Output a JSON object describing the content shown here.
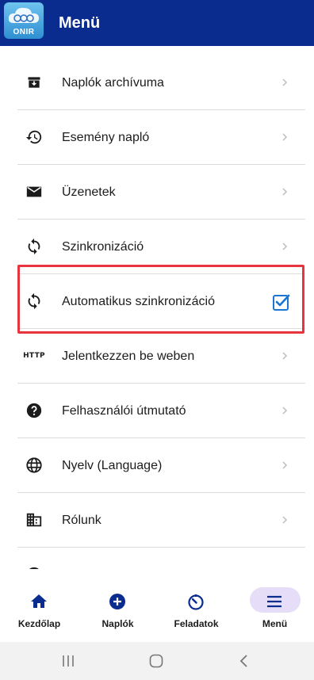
{
  "header": {
    "title": "Menü",
    "logo_text": "ONIR"
  },
  "menu": {
    "items": [
      {
        "label": "Naplók archívuma",
        "icon": "archive-icon"
      },
      {
        "label": "Esemény napló",
        "icon": "history-icon"
      },
      {
        "label": "Üzenetek",
        "icon": "mail-icon"
      },
      {
        "label": "Szinkronizáció",
        "icon": "sync-icon"
      },
      {
        "label": "Automatikus szinkronizáció",
        "icon": "sync-icon",
        "checked": true
      },
      {
        "label": "Jelentkezzen be weben",
        "icon": "http-icon",
        "icon_text": "HTTP"
      },
      {
        "label": "Felhasználói útmutató",
        "icon": "help-icon"
      },
      {
        "label": "Nyelv (Language)",
        "icon": "globe-icon"
      },
      {
        "label": "Rólunk",
        "icon": "domain-icon"
      }
    ]
  },
  "bottom_nav": {
    "items": [
      {
        "label": "Kezdőlap",
        "icon": "home-icon"
      },
      {
        "label": "Naplók",
        "icon": "add-circle-icon"
      },
      {
        "label": "Feladatok",
        "icon": "timer-icon"
      },
      {
        "label": "Menü",
        "icon": "menu-icon",
        "active": true
      }
    ]
  },
  "colors": {
    "header_bg": "#0a2c8f",
    "accent": "#1976d2",
    "highlight": "#e8343f",
    "active_pill": "#e6def8"
  }
}
